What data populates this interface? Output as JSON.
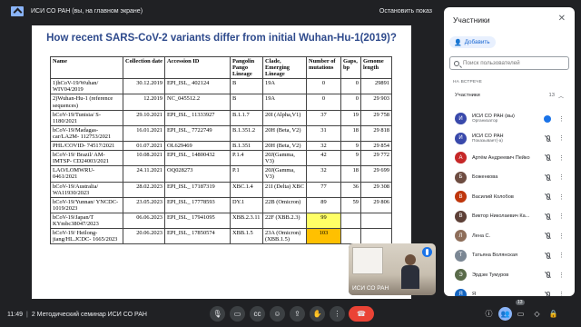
{
  "banner": {
    "title": "ИСИ СО РАН (вы, на главном экране)",
    "stop_label": "Остановить показ"
  },
  "slide": {
    "title": "How recent SARS-CoV-2 variants differ from initial Wuhan-Hu-1(2019)?",
    "headers": [
      "Name",
      "Collection date",
      "Accession ID",
      "Pangolin Pango Lineage",
      "Clade, Emerging Lineage",
      "Number of mutations",
      "Gaps, bp",
      "Genome length"
    ],
    "rows": [
      [
        "1)hCoV-19/Wuhan/ WIV04/2019",
        "30.12.2019",
        "EPI_ISL_ 402124",
        "B",
        "19A",
        "0",
        "0",
        "29891"
      ],
      [
        "2)Wuhan-Hu-1 (reference sequences)",
        "12.2019",
        "NC_045512.2",
        "B",
        "19A",
        "0",
        "0",
        "29 903"
      ],
      [
        "hCoV-19/Tunisia/ S-1180/2021",
        "29.10.2021",
        "EPI_ISL_ 11333927",
        "B.1.1.7",
        "20I (Alpha,V1)",
        "37",
        "19",
        "29 758"
      ],
      [
        "hCoV-19/Madagas- car/LA2M- 112753/2021",
        "16.01.2021",
        "EPI_ISL_ 7722749",
        "B.1.351.2",
        "20H (Beta, V2)",
        "31",
        "18",
        "29 818"
      ],
      [
        "PHL/COVID- 74517/2021",
        "01.07.2021",
        "OL629469",
        "B.1.351",
        "20H (Beta, V2)",
        "32",
        "9",
        "29 854"
      ],
      [
        "hCoV-19/ Brazil/ AM-IMTSP- CD24003/2021",
        "10.08.2021",
        "EPI_ISL_ 14800432",
        "P.1.4",
        "20J(Gamma, V3)",
        "42",
        "9",
        "29 772"
      ],
      [
        "LAO/LOMWRU- 0461/2021",
        "24.11.2021",
        "OQ028273",
        "P.1",
        "20J(Gamma, V3)",
        "32",
        "18",
        "29 699"
      ],
      [
        "hCoV-19/Australia/ WA11930/2023",
        "28.02.2023",
        "EPI_ISL_ 17187319",
        "XBC.1.4",
        "21I (Delta) XBC",
        "77",
        "36",
        "29 308"
      ],
      [
        "hCoV-19/Yunnan/ YNCDC-1019/2023",
        "23.05.2023",
        "EPI_ISL_ 17778593",
        "DY.1",
        "22B (Omicron)",
        "89",
        "59",
        "29 806"
      ],
      [
        "hCoV-19/Japan/T KYmbc38047/2023",
        "06.06.2023",
        "EPI_ISL_ 17941095",
        "XBB.2.3.11",
        "22F (XBB.2.3)",
        "99",
        "",
        ""
      ],
      [
        "hCoV-19/ Heilong- jiang/HL.JCDC- 1665/2023",
        "20.06.2023",
        "EPI_ISL_ 17850574",
        "XBB.1.5",
        "23A (Omicron) (XBB.1.5)",
        "103",
        "",
        ""
      ]
    ]
  },
  "selfview": {
    "name": "ИСИ СО РАН"
  },
  "bottombar": {
    "time": "11:49",
    "separator": "|",
    "meeting_title": "2 Методический семинар ИСИ СО РАН",
    "participants_badge": "13"
  },
  "panel": {
    "title": "Участники",
    "add_label": "Добавить",
    "search_placeholder": "Поиск пользователей",
    "section_label": "НА ВСТРЕЧЕ",
    "group_label": "Участники",
    "group_count": "13",
    "participants": [
      {
        "name": "ИСИ СО РАН (вы)",
        "sub": "Организатор",
        "avatar_color": "#3949ab",
        "initial": "И",
        "state": "speaking"
      },
      {
        "name": "ИСИ СО РАН",
        "sub": "Показывает(-а)",
        "avatar_color": "#3949ab",
        "initial": "И",
        "state": "muted"
      },
      {
        "name": "Артём Андреевич Пейко",
        "sub": "",
        "avatar_color": "#c62828",
        "initial": "А",
        "state": "muted"
      },
      {
        "name": "Боженкова",
        "sub": "",
        "avatar_color": "#6d4c41",
        "initial": "Б",
        "state": "muted"
      },
      {
        "name": "Василий Колобов",
        "sub": "",
        "avatar_color": "#bf360c",
        "initial": "В",
        "state": "muted"
      },
      {
        "name": "Виктор Николаевич Ка...",
        "sub": "",
        "avatar_color": "#5d4037",
        "initial": "В",
        "state": "muted"
      },
      {
        "name": "Лена С.",
        "sub": "",
        "avatar_color": "#8e6e5a",
        "initial": "Л",
        "state": "muted"
      },
      {
        "name": "Татьяна Волянская",
        "sub": "",
        "avatar_color": "#7b8794",
        "initial": "Т",
        "state": "muted"
      },
      {
        "name": "Эрдэм Тумуров",
        "sub": "",
        "avatar_color": "#5a6b4a",
        "initial": "Э",
        "state": "muted"
      },
      {
        "name": "Я",
        "sub": "",
        "avatar_color": "#1565c0",
        "initial": "Я",
        "state": "muted"
      }
    ]
  }
}
